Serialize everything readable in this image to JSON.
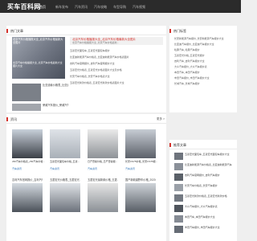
{
  "site": {
    "logo": "买车百科网"
  },
  "nav": [
    {
      "label": "首页"
    },
    {
      "label": "新车发布"
    },
    {
      "label": "汽车资讯"
    },
    {
      "label": "汽车攻略"
    },
    {
      "label": "车型导购"
    },
    {
      "label": "汽车视频"
    }
  ],
  "hot": {
    "title": "热门文章",
    "hero_caption": "北京汽车价格播报大全_北京汽车价格最新大全图片",
    "hero_sub": "北京汽车价格播报大全_北京汽车价格最新大全图片大全",
    "featured_title": "北京汽车价格播报大全_北京汽车价格最新大全图片",
    "featured_desc": "北京汽车价格播报大全_北京汽车价格最新...",
    "items": [
      "五菱宏光面包车_五菱宏光面包车报价",
      "比亚迪新能源汽车价格表_比亚迪新能源汽车价格表图片",
      "吉利汽车官网报价_吉利汽车官网报价大全",
      "五菱宏光价格表_五菱宏光价格表图片大全及价格",
      "长安汽车价格表_长安汽车价格表大全",
      "五菱宏光新款价格表_五菱宏光新款价格表图片大全"
    ],
    "left_items": [
      {
        "title": "比亚迪秦价格表_比亚迪秦价格表图片",
        "tag": "汽车资讯"
      },
      {
        "title": "荣威汽车报价_荣威汽车报价大全",
        "tag": "汽车资讯"
      }
    ]
  },
  "sidebar": {
    "title": "热门标签",
    "ranks": [
      "长安新能源汽车报价_长安新能源汽车报价大全",
      "比亚迪汽车报价_比亚迪汽车报价大全",
      "哈弗汽车_哈弗汽车报价",
      "五菱宏光价格_五菱宏光报价",
      "吉利汽车_吉利汽车报价大全",
      "大众汽车报价_大众汽车报价表",
      "本田汽车_本田汽车报价",
      "丰田汽车报价_丰田汽车报价大全",
      "长城汽车_长城汽车报价"
    ]
  },
  "latest": {
    "title": "资讯",
    "more": "更多 >",
    "grid": [
      {
        "caption": "c50汽车价格表_c50汽车价格...",
        "tag": "汽车资讯"
      },
      {
        "caption": "五菱宏光面包车价格_五菱...",
        "tag": "汽车资讯"
      },
      {
        "caption": "日产奇骏价格_日产奇骏报...",
        "tag": "汽车资讯"
      },
      {
        "caption": "长安CS75价格_长安CS75报...",
        "tag": "汽车资讯"
      }
    ],
    "bottom": [
      "吉利汽车官网报价_吉利汽车...",
      "五菱宏光价格表_五菱宏光...",
      "五菱宏光最新款价格_五菱...",
      "国产新款越野车价格_2020年..."
    ]
  },
  "right2": {
    "title": "推荐文章",
    "items": [
      "五菱宏光面包车_五菱宏光面包车报价大全",
      "比亚迪新能源汽车价格表_比亚迪新能源汽车",
      "吉利汽车官网报价_吉利汽车报价",
      "长安汽车价格表_长安汽车报价",
      "五菱宏光新款价格表_五菱宏光新款价格",
      "大众汽车报价_大众汽车报价表",
      "本田汽车_本田汽车报价大全",
      "丰田汽车报价_丰田汽车报价大全"
    ]
  },
  "colors": {
    "accent": "#d6322c",
    "header": "#2b2b2b",
    "link": "#2a6fb5"
  }
}
